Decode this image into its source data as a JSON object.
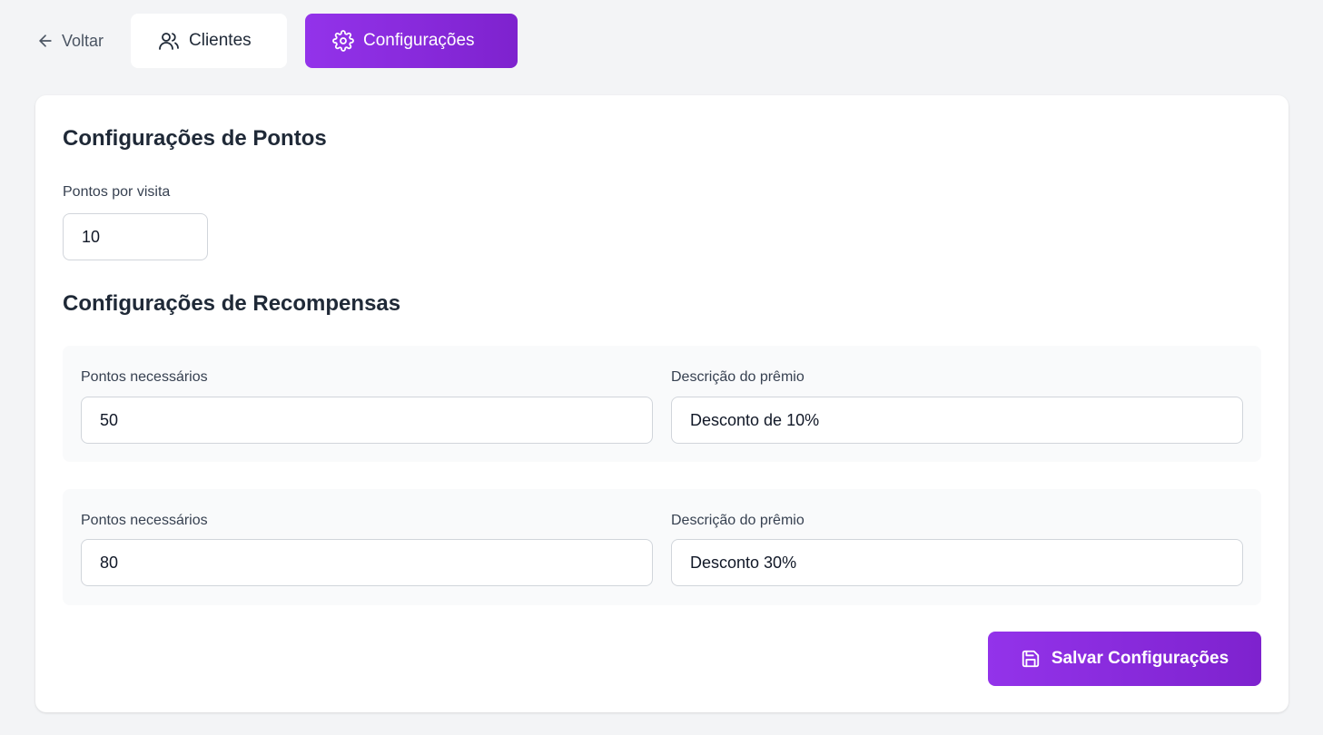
{
  "nav": {
    "back_label": "Voltar",
    "tabs": [
      {
        "label": "Clientes",
        "icon": "users-icon",
        "active": false
      },
      {
        "label": "Configurações",
        "icon": "gear-icon",
        "active": true
      }
    ]
  },
  "points_section": {
    "title": "Configurações de Pontos",
    "points_per_visit_label": "Pontos por visita",
    "points_per_visit_value": "10"
  },
  "rewards_section": {
    "title": "Configurações de Recompensas",
    "rewards": [
      {
        "points_label": "Pontos necessários",
        "points_value": "50",
        "description_label": "Descrição do prêmio",
        "description_value": "Desconto de 10%"
      },
      {
        "points_label": "Pontos necessários",
        "points_value": "80",
        "description_label": "Descrição do prêmio",
        "description_value": "Desconto 30%"
      }
    ]
  },
  "save_button": {
    "label": "Salvar Configurações",
    "icon": "save-icon"
  },
  "colors": {
    "accent_start": "#9333ea",
    "accent_end": "#7e22ce",
    "background": "#f3f4f6",
    "card": "#ffffff",
    "reward_panel": "#f9fafb"
  }
}
